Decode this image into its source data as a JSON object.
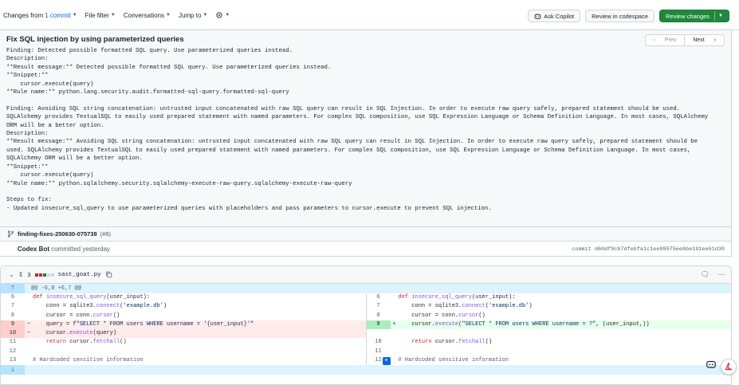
{
  "toolbar": {
    "changes_prefix": "Changes from ",
    "changes_link": "1 commit",
    "file_filter": "File filter",
    "conversations": "Conversations",
    "jump_to": "Jump to",
    "ask_copilot": "Ask Copilot",
    "review_in_codespace": "Review in codespace",
    "review_changes": "Review changes"
  },
  "commit": {
    "title": "Fix SQL injection by using parameterized queries",
    "prev_label": "Prev",
    "next_label": "Next",
    "description": "Finding: Detected possible formatted SQL query. Use parameterized queries instead.\nDescription:\n**Result message:** Detected possible formatted SQL query. Use parameterized queries instead.\n**Snippet:**\n    cursor.execute(query)\n**Rule name:** python.lang.security.audit.formatted-sql-query.formatted-sql-query\n\nFinding: Avoiding SQL string concatenation: untrusted input concatenated with raw SQL query can result in SQL Injection. In order to execute raw query safely, prepared statement should be used.\nSQLAlchemy provides TextualSQL to easily used prepared statement with named parameters. For complex SQL composition, use SQL Expression Language or Schema Definition Language. In most cases, SQLAlchemy\nORM will be a better option.\nDescription:\n**Result message:** Avoiding SQL string concatenation: untrusted input concatenated with raw SQL query can result in SQL Injection. In order to execute raw query safely, prepared statement should be\nused. SQLAlchemy provides TextualSQL to easily used prepared statement with named parameters. For complex SQL composition, use SQL Expression Language or Schema Definition Language. In most cases,\nSQLAlchemy ORM will be a better option.\n**Snippet:**\n    cursor.execute(query)\n**Rule name:** python.sqlalchemy.security.sqlalchemy-execute-raw-query.sqlalchemy-execute-raw-query\n\nSteps to fix:\n- Updated insecure_sql_query to use parameterized queries with placeholders and pass parameters to cursor.execute to prevent SQL injection.",
    "branch": "finding-fixes-250630-075738",
    "pr_ref": "(#8)",
    "author": "Codex Bot",
    "committed_text": "committed yesterday",
    "hash_text": "commit d60df9cb7dfebfa1c1ee99075ee6be191ee61d30"
  },
  "file": {
    "changes_count": "3",
    "name": "sast_goat.py",
    "hunk_header": "@@ -6,8 +6,7 @@",
    "left": [
      {
        "type": "ctx",
        "num": "6",
        "marker": "",
        "code": "def insecure_sql_query(user_input):"
      },
      {
        "type": "ctx",
        "num": "7",
        "marker": "",
        "code": "    conn = sqlite3.connect('example.db')"
      },
      {
        "type": "ctx",
        "num": "8",
        "marker": "",
        "code": "    cursor = conn.cursor()"
      },
      {
        "type": "del",
        "num": "9",
        "marker": "−",
        "code": "    query = f\"SELECT * FROM users WHERE username = '{user_input}'\""
      },
      {
        "type": "del",
        "num": "10",
        "marker": "−",
        "code": "    cursor.execute(query)"
      },
      {
        "type": "ctx",
        "num": "11",
        "marker": "",
        "code": "    return cursor.fetchall()"
      },
      {
        "type": "ctx",
        "num": "12",
        "marker": "",
        "code": ""
      },
      {
        "type": "ctx",
        "num": "13",
        "marker": "",
        "code": "# Hardcoded sensitive information"
      }
    ],
    "right": [
      {
        "type": "ctx",
        "num": "6",
        "marker": "",
        "code": "def insecure_sql_query(user_input):"
      },
      {
        "type": "ctx",
        "num": "7",
        "marker": "",
        "code": "    conn = sqlite3.connect('example.db')"
      },
      {
        "type": "ctx",
        "num": "8",
        "marker": "",
        "code": "    cursor = conn.cursor()"
      },
      {
        "type": "add",
        "num": "9",
        "marker": "+",
        "code": "    cursor.execute(\"SELECT * FROM users WHERE username = ?\", (user_input,))"
      },
      {
        "type": "empty",
        "num": "",
        "marker": "",
        "code": ""
      },
      {
        "type": "ctx",
        "num": "10",
        "marker": "",
        "code": "    return cursor.fetchall()"
      },
      {
        "type": "ctx",
        "num": "11",
        "marker": "",
        "code": ""
      },
      {
        "type": "ctx",
        "num": "12",
        "marker": "",
        "code": "# Hardcoded sensitive information"
      }
    ]
  },
  "colors": {
    "accent": "#0969da",
    "review_green": "#1f883d",
    "deletion_bg": "#ffebe9",
    "addition_bg": "#e6ffec"
  }
}
